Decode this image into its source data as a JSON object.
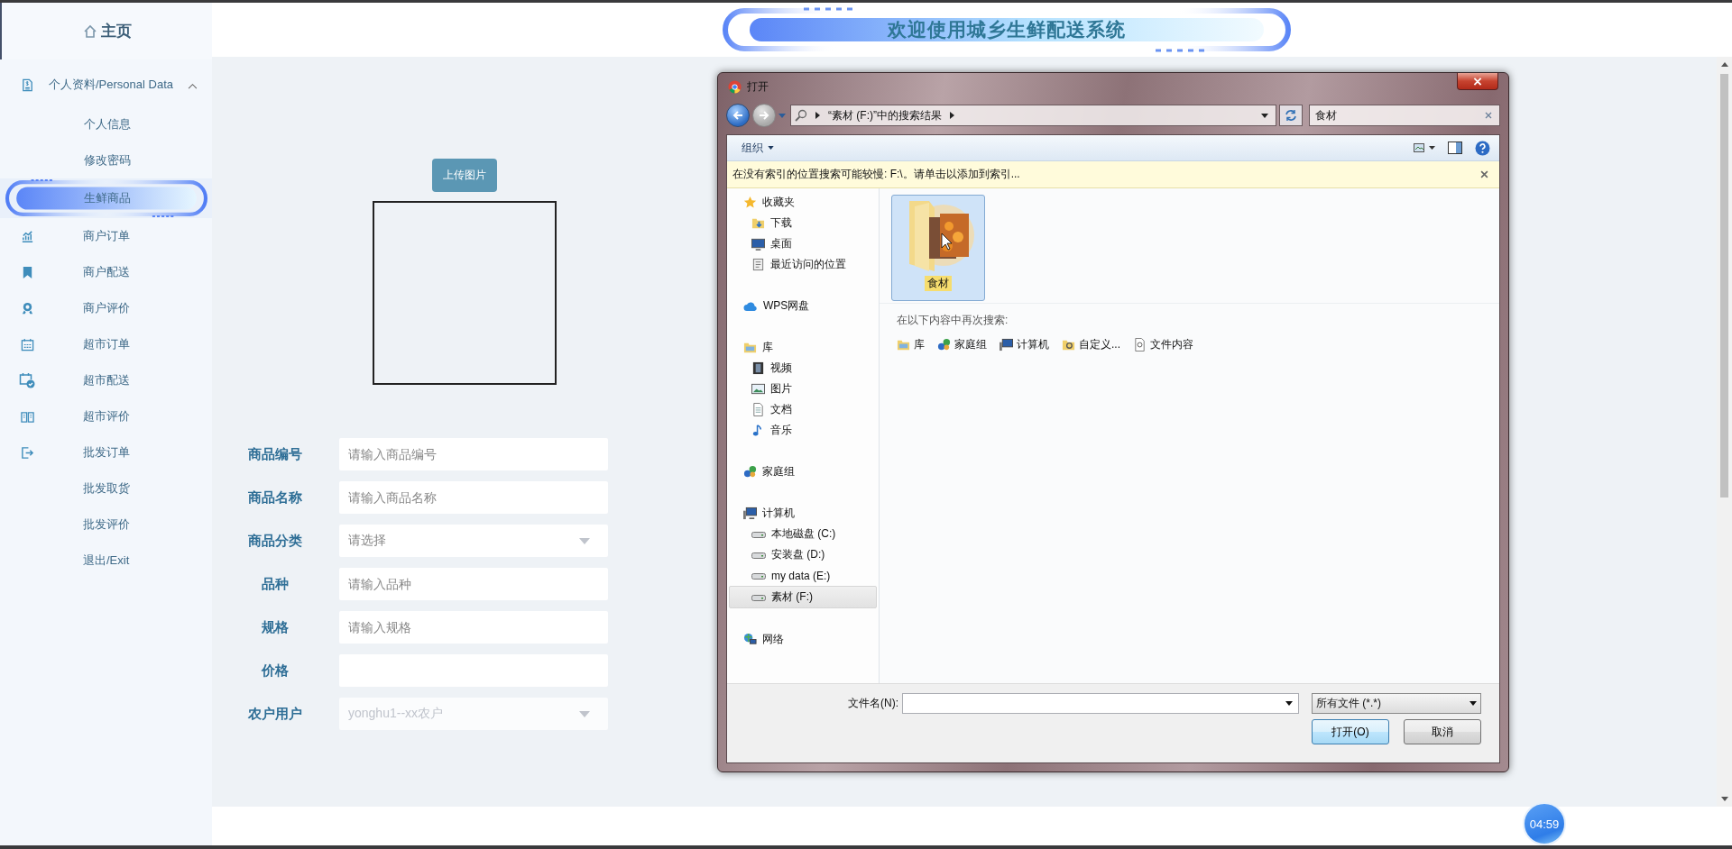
{
  "header": {
    "title": "欢迎使用城乡生鲜配送系统"
  },
  "sidebar": {
    "home": "主页",
    "items": [
      {
        "label": "个人资料/Personal Data",
        "expanded": true,
        "selected": false,
        "children": [
          {
            "label": "个人信息",
            "selected": false
          },
          {
            "label": "修改密码",
            "selected": false
          },
          {
            "label": "生鲜商品",
            "selected": true
          }
        ]
      },
      {
        "label": "商户订单",
        "selected": false
      },
      {
        "label": "商户配送",
        "selected": false
      },
      {
        "label": "商户评价",
        "selected": false
      },
      {
        "label": "超市订单",
        "selected": false
      },
      {
        "label": "超市配送",
        "selected": false
      },
      {
        "label": "超市评价",
        "selected": false
      },
      {
        "label": "批发订单",
        "selected": false
      },
      {
        "label": "批发取货",
        "selected": false
      },
      {
        "label": "批发评价",
        "selected": false
      },
      {
        "label": "退出/Exit",
        "selected": false
      }
    ]
  },
  "form": {
    "upload_button": "上传图片",
    "fields": [
      {
        "label": "商品编号",
        "kind": "input",
        "placeholder": "请输入商品编号",
        "disabled": false
      },
      {
        "label": "商品名称",
        "kind": "input",
        "placeholder": "请输入商品名称",
        "disabled": false
      },
      {
        "label": "商品分类",
        "kind": "select",
        "placeholder": "请选择",
        "disabled": false
      },
      {
        "label": "品种",
        "kind": "input",
        "placeholder": "请输入品种",
        "disabled": false
      },
      {
        "label": "规格",
        "kind": "input",
        "placeholder": "请输入规格",
        "disabled": false
      },
      {
        "label": "价格",
        "kind": "input",
        "disabled": false
      },
      {
        "label": "农户用户",
        "kind": "select",
        "value": "yonghu1--xx农户",
        "disabled": true
      }
    ]
  },
  "dialog": {
    "title": "打开",
    "breadcrumb": "“素材 (F:)”中的搜索结果",
    "search_value": "食材",
    "organize": "组织",
    "info_bar": "在没有索引的位置搜索可能较慢: F:\\。请单击以添加到索引...",
    "nav": [
      {
        "label": "收藏夹",
        "selected": false,
        "children": [
          {
            "label": "下载",
            "selected": false
          },
          {
            "label": "桌面",
            "selected": false
          },
          {
            "label": "最近访问的位置",
            "selected": false
          }
        ]
      },
      {
        "label": "WPS网盘",
        "selected": false
      },
      {
        "label": "库",
        "selected": false,
        "children": [
          {
            "label": "视频",
            "selected": false
          },
          {
            "label": "图片",
            "selected": false
          },
          {
            "label": "文档",
            "selected": false
          },
          {
            "label": "音乐",
            "selected": false
          }
        ]
      },
      {
        "label": "家庭组",
        "selected": false
      },
      {
        "label": "计算机",
        "selected": false,
        "children": [
          {
            "label": "本地磁盘 (C:)",
            "selected": false
          },
          {
            "label": "安装盘 (D:)",
            "selected": false
          },
          {
            "label": "my data (E:)",
            "selected": false
          },
          {
            "label": "素材 (F:)",
            "selected": true
          }
        ]
      },
      {
        "label": "网络",
        "selected": false
      }
    ],
    "files": [
      {
        "name": "食材",
        "selected": true
      }
    ],
    "search_again": {
      "label": "在以下内容中再次搜索:",
      "items": [
        "库",
        "家庭组",
        "计算机",
        "自定义...",
        "文件内容"
      ]
    },
    "filename_label": "文件名(N):",
    "filter": "所有文件 (*.*)",
    "buttons": [
      {
        "label": "打开(O)",
        "default": true
      },
      {
        "label": "取消",
        "default": false
      }
    ]
  },
  "timer": "04:59"
}
